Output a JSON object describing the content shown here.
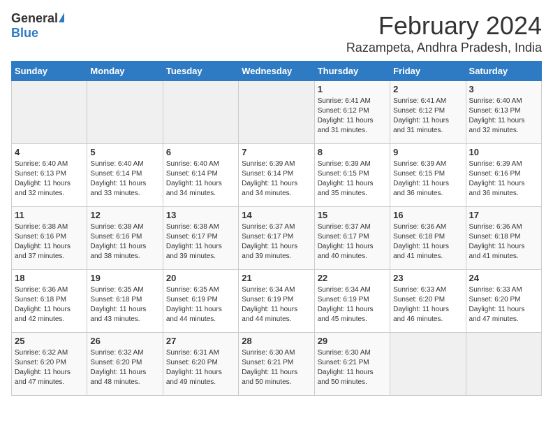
{
  "logo": {
    "general": "General",
    "blue": "Blue"
  },
  "title": {
    "month": "February 2024",
    "location": "Razampeta, Andhra Pradesh, India"
  },
  "headers": [
    "Sunday",
    "Monday",
    "Tuesday",
    "Wednesday",
    "Thursday",
    "Friday",
    "Saturday"
  ],
  "weeks": [
    [
      {
        "day": "",
        "info": ""
      },
      {
        "day": "",
        "info": ""
      },
      {
        "day": "",
        "info": ""
      },
      {
        "day": "",
        "info": ""
      },
      {
        "day": "1",
        "info": "Sunrise: 6:41 AM\nSunset: 6:12 PM\nDaylight: 11 hours\nand 31 minutes."
      },
      {
        "day": "2",
        "info": "Sunrise: 6:41 AM\nSunset: 6:12 PM\nDaylight: 11 hours\nand 31 minutes."
      },
      {
        "day": "3",
        "info": "Sunrise: 6:40 AM\nSunset: 6:13 PM\nDaylight: 11 hours\nand 32 minutes."
      }
    ],
    [
      {
        "day": "4",
        "info": "Sunrise: 6:40 AM\nSunset: 6:13 PM\nDaylight: 11 hours\nand 32 minutes."
      },
      {
        "day": "5",
        "info": "Sunrise: 6:40 AM\nSunset: 6:14 PM\nDaylight: 11 hours\nand 33 minutes."
      },
      {
        "day": "6",
        "info": "Sunrise: 6:40 AM\nSunset: 6:14 PM\nDaylight: 11 hours\nand 34 minutes."
      },
      {
        "day": "7",
        "info": "Sunrise: 6:39 AM\nSunset: 6:14 PM\nDaylight: 11 hours\nand 34 minutes."
      },
      {
        "day": "8",
        "info": "Sunrise: 6:39 AM\nSunset: 6:15 PM\nDaylight: 11 hours\nand 35 minutes."
      },
      {
        "day": "9",
        "info": "Sunrise: 6:39 AM\nSunset: 6:15 PM\nDaylight: 11 hours\nand 36 minutes."
      },
      {
        "day": "10",
        "info": "Sunrise: 6:39 AM\nSunset: 6:16 PM\nDaylight: 11 hours\nand 36 minutes."
      }
    ],
    [
      {
        "day": "11",
        "info": "Sunrise: 6:38 AM\nSunset: 6:16 PM\nDaylight: 11 hours\nand 37 minutes."
      },
      {
        "day": "12",
        "info": "Sunrise: 6:38 AM\nSunset: 6:16 PM\nDaylight: 11 hours\nand 38 minutes."
      },
      {
        "day": "13",
        "info": "Sunrise: 6:38 AM\nSunset: 6:17 PM\nDaylight: 11 hours\nand 39 minutes."
      },
      {
        "day": "14",
        "info": "Sunrise: 6:37 AM\nSunset: 6:17 PM\nDaylight: 11 hours\nand 39 minutes."
      },
      {
        "day": "15",
        "info": "Sunrise: 6:37 AM\nSunset: 6:17 PM\nDaylight: 11 hours\nand 40 minutes."
      },
      {
        "day": "16",
        "info": "Sunrise: 6:36 AM\nSunset: 6:18 PM\nDaylight: 11 hours\nand 41 minutes."
      },
      {
        "day": "17",
        "info": "Sunrise: 6:36 AM\nSunset: 6:18 PM\nDaylight: 11 hours\nand 41 minutes."
      }
    ],
    [
      {
        "day": "18",
        "info": "Sunrise: 6:36 AM\nSunset: 6:18 PM\nDaylight: 11 hours\nand 42 minutes."
      },
      {
        "day": "19",
        "info": "Sunrise: 6:35 AM\nSunset: 6:18 PM\nDaylight: 11 hours\nand 43 minutes."
      },
      {
        "day": "20",
        "info": "Sunrise: 6:35 AM\nSunset: 6:19 PM\nDaylight: 11 hours\nand 44 minutes."
      },
      {
        "day": "21",
        "info": "Sunrise: 6:34 AM\nSunset: 6:19 PM\nDaylight: 11 hours\nand 44 minutes."
      },
      {
        "day": "22",
        "info": "Sunrise: 6:34 AM\nSunset: 6:19 PM\nDaylight: 11 hours\nand 45 minutes."
      },
      {
        "day": "23",
        "info": "Sunrise: 6:33 AM\nSunset: 6:20 PM\nDaylight: 11 hours\nand 46 minutes."
      },
      {
        "day": "24",
        "info": "Sunrise: 6:33 AM\nSunset: 6:20 PM\nDaylight: 11 hours\nand 47 minutes."
      }
    ],
    [
      {
        "day": "25",
        "info": "Sunrise: 6:32 AM\nSunset: 6:20 PM\nDaylight: 11 hours\nand 47 minutes."
      },
      {
        "day": "26",
        "info": "Sunrise: 6:32 AM\nSunset: 6:20 PM\nDaylight: 11 hours\nand 48 minutes."
      },
      {
        "day": "27",
        "info": "Sunrise: 6:31 AM\nSunset: 6:20 PM\nDaylight: 11 hours\nand 49 minutes."
      },
      {
        "day": "28",
        "info": "Sunrise: 6:30 AM\nSunset: 6:21 PM\nDaylight: 11 hours\nand 50 minutes."
      },
      {
        "day": "29",
        "info": "Sunrise: 6:30 AM\nSunset: 6:21 PM\nDaylight: 11 hours\nand 50 minutes."
      },
      {
        "day": "",
        "info": ""
      },
      {
        "day": "",
        "info": ""
      }
    ]
  ]
}
